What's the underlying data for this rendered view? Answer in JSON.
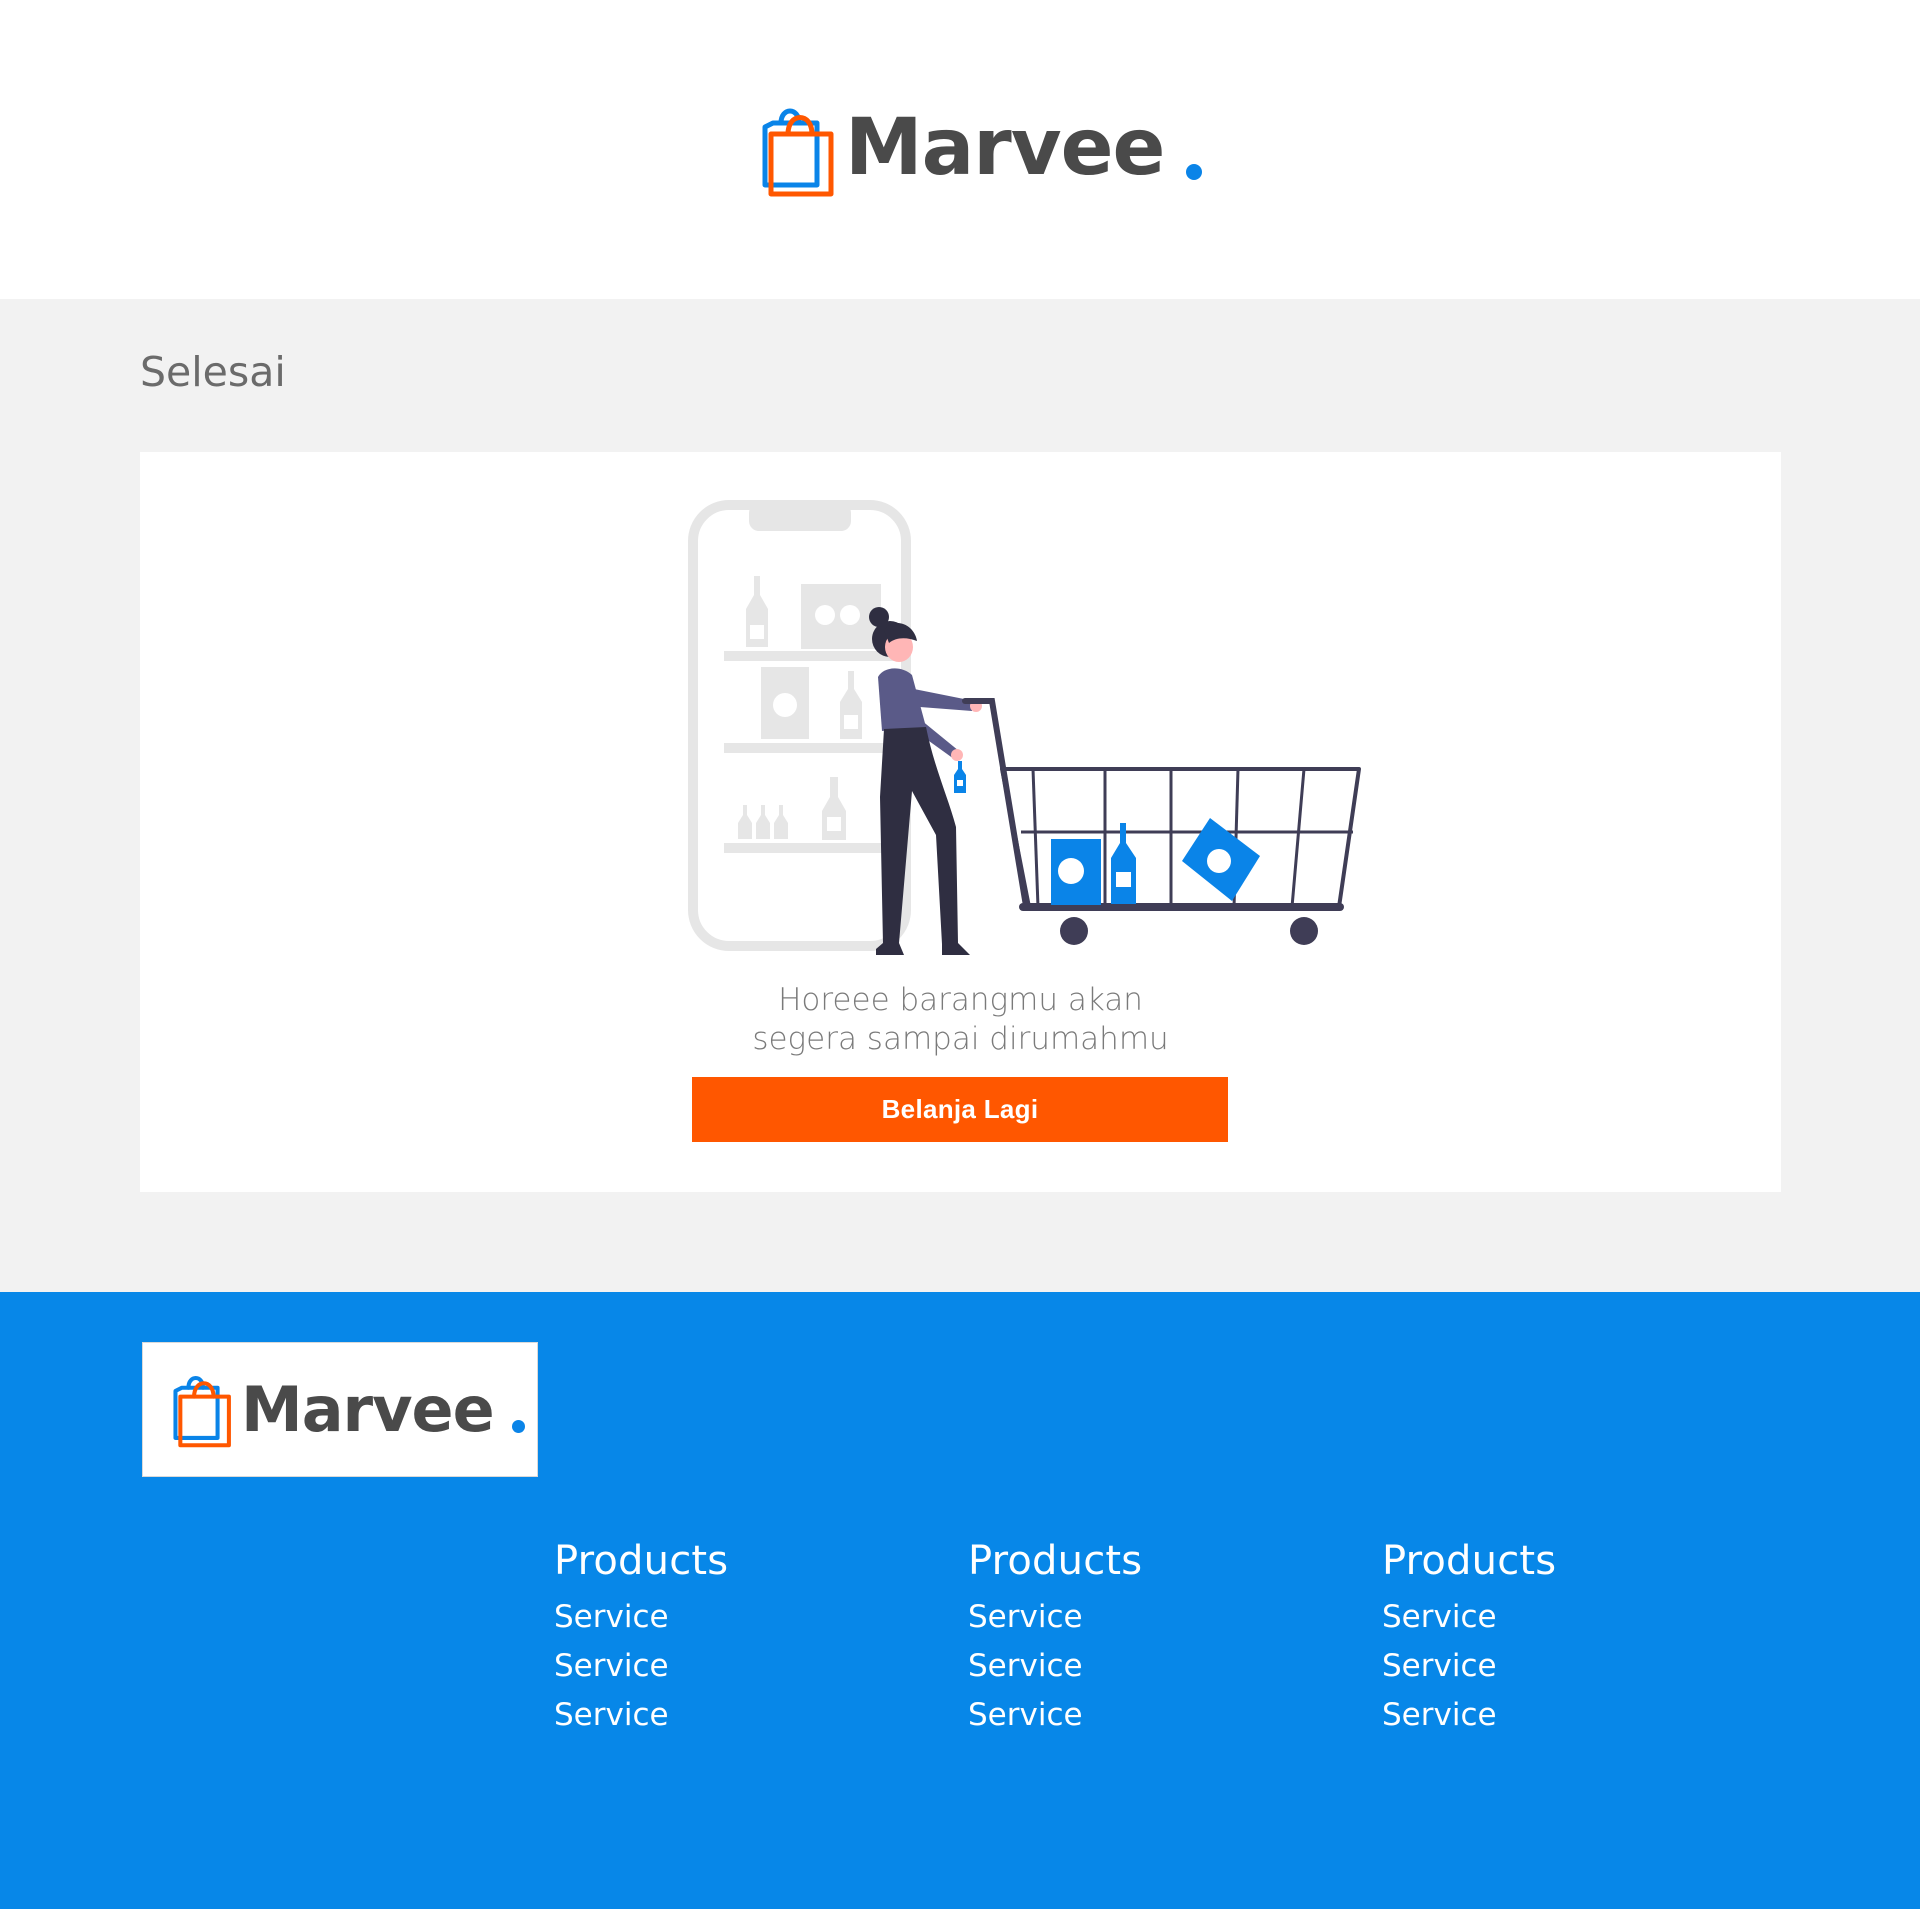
{
  "header": {
    "brand_name": "Marvee",
    "brand_dot": "."
  },
  "main": {
    "section_title": "Selesai",
    "message_line_1": "Horeee barangmu akan",
    "message_line_2": "segera sampai dirumahmu",
    "button_label": "Belanja Lagi",
    "illustration": "shopping-cart-illustration"
  },
  "footer": {
    "brand_name": "Marvee",
    "brand_dot": ".",
    "columns": [
      {
        "title": "Products",
        "links": [
          "Service",
          "Service",
          "Service"
        ]
      },
      {
        "title": "Products",
        "links": [
          "Service",
          "Service",
          "Service"
        ]
      },
      {
        "title": "Products",
        "links": [
          "Service",
          "Service",
          "Service"
        ]
      }
    ]
  },
  "colors": {
    "primary_blue": "#0787e8",
    "accent_orange": "#ff5700",
    "text_dark": "#4a4a4a",
    "text_muted": "#7a7a7a",
    "background_gray": "#f2f2f2"
  }
}
